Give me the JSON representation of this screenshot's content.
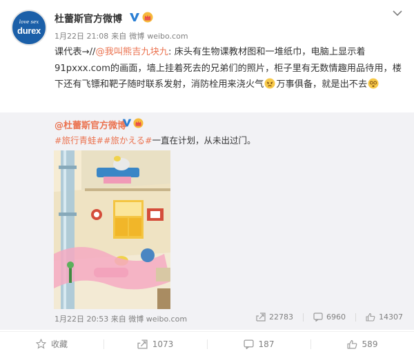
{
  "author": {
    "name": "杜蕾斯官方微博",
    "avatar_text_small": "love sex",
    "avatar_text_brand": "durex"
  },
  "meta": {
    "time": "1月22日 21:08",
    "source_prefix": "来自",
    "source_1": "微博",
    "source_2": "weibo.com"
  },
  "post": {
    "part1": "课代表→//",
    "mention": "@我叫熊吉九块九",
    "part2": ": 床头有生物课教材图和一堆纸巾，电脑上显示着91pxxx.com的画面，墙上挂着死去的兄弟们的照片，柜子里有无数情趣用品待用，楼下还有飞镖和靶子随时联系发射，消防栓用来浇火气",
    "part3": "万事俱备，就是出不去"
  },
  "repost": {
    "author": "@杜蕾斯官方微博",
    "tag1": "#旅行青蛙#",
    "tag2": "#旅かえる#",
    "text": "一直在计划，从未出过门。",
    "time": "1月22日 20:53",
    "source_prefix": "来自",
    "source_1": "微博",
    "source_2": "weibo.com",
    "shares": "22783",
    "comments": "6960",
    "likes": "14307"
  },
  "actions": {
    "favorite": "收藏",
    "forward": "1073",
    "comment": "187",
    "like": "589"
  },
  "colors": {
    "link": "#eb7350",
    "avatar_bg": "#1b5fa8",
    "repost_bg": "#f2f2f5",
    "muted": "#808080"
  }
}
